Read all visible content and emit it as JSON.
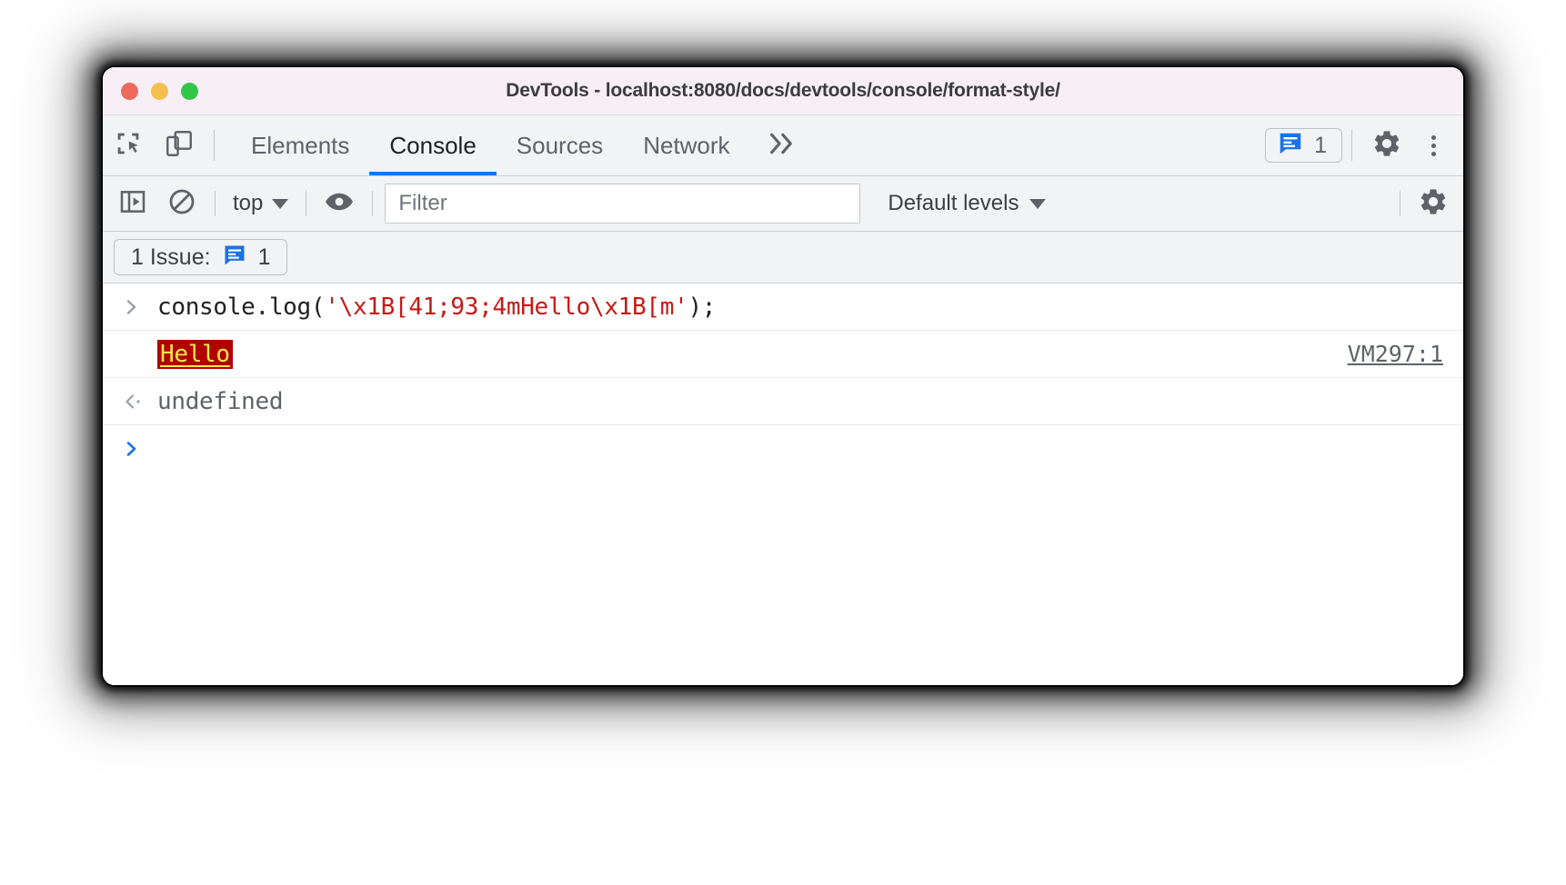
{
  "window": {
    "title": "DevTools - localhost:8080/docs/devtools/console/format-style/",
    "traffic_lights": {
      "close": "close-window",
      "minimize": "minimize-window",
      "zoom": "zoom-window"
    }
  },
  "main_toolbar": {
    "inspect_icon": "inspect-element-icon",
    "device_icon": "device-toolbar-icon",
    "tabs": [
      {
        "label": "Elements",
        "active": false
      },
      {
        "label": "Console",
        "active": true
      },
      {
        "label": "Sources",
        "active": false
      },
      {
        "label": "Network",
        "active": false
      }
    ],
    "more_tabs_label": "»",
    "issues_badge": {
      "icon": "issues-message-icon",
      "count": "1"
    },
    "settings_icon": "gear-icon",
    "menu_icon": "kebab-menu-icon"
  },
  "filter_toolbar": {
    "sidebar_toggle_icon": "console-sidebar-icon",
    "clear_console_icon": "clear-console-icon",
    "context_selector": {
      "value": "top",
      "caret": "chevron-down-icon"
    },
    "live_expression_icon": "eye-icon",
    "filter": {
      "placeholder": "Filter",
      "value": ""
    },
    "levels": {
      "value": "Default levels",
      "caret": "chevron-down-icon"
    },
    "console_settings_icon": "gear-icon"
  },
  "issues_bar": {
    "label": "1 Issue:",
    "icon": "issues-message-icon",
    "count": "1"
  },
  "console": {
    "input_row": {
      "gutter": "›",
      "code_prefix": "console.log(",
      "code_string": "'\\x1B[41;93;4mHello\\x1B[m'",
      "code_suffix": ");"
    },
    "output_row": {
      "text": "Hello",
      "fg_color": "#fbe74b",
      "bg_color": "#b00000",
      "underline": true,
      "source": "VM297:1"
    },
    "result_row": {
      "gutter": "‹·",
      "value": "undefined"
    },
    "prompt_row": {
      "caret": "›"
    }
  },
  "colors": {
    "accent": "#1a73e8",
    "titlebar_bg": "#f7eef6",
    "toolbar_bg": "#f1f3f4",
    "string_token": "#c41a16",
    "ansi_bg": "#b00000",
    "ansi_fg": "#fbe74b"
  }
}
